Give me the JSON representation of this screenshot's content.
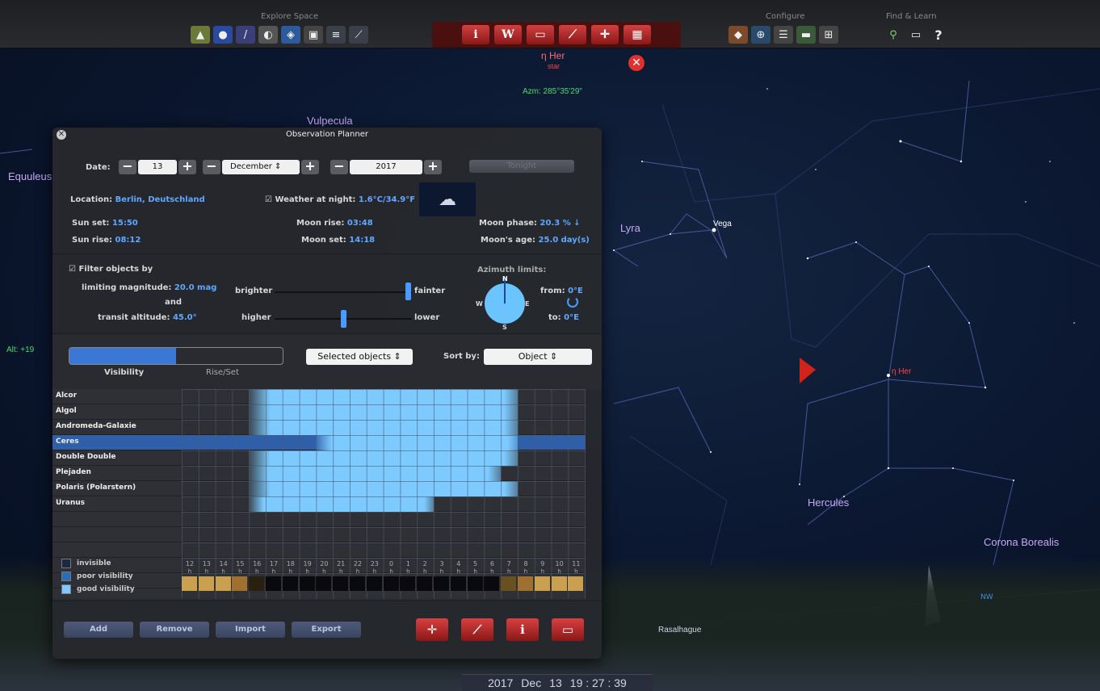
{
  "toolbar": {
    "explore_label": "Explore Space",
    "configure_label": "Configure",
    "find_label": "Find & Learn"
  },
  "sky": {
    "constellations": [
      "Vulpecula",
      "Equuleus",
      "Lyra",
      "Hercules",
      "Corona Borealis"
    ],
    "stars": [
      "Vega",
      "Rasalhague"
    ],
    "selected_marker": "η Her",
    "alt_readout": "Alt: +19",
    "nw_label": "NW"
  },
  "object_info": {
    "name": "η Her",
    "type": "star",
    "azimuth": "Azm: 285°35'29\""
  },
  "datetime": {
    "year": "2017",
    "month": "Dec",
    "day": "13",
    "time": "19 : 27 : 39"
  },
  "planner": {
    "title": "Observation Planner",
    "date_label": "Date:",
    "day": "13",
    "month": "December",
    "year": "2017",
    "tonight_button": "Tonight",
    "location_label": "Location:",
    "location_value": "Berlin, Deutschland",
    "weather_label": "Weather at night:",
    "weather_value": "1.6°C/34.9°F",
    "sun_set_label": "Sun set:",
    "sun_set": "15:50",
    "sun_rise_label": "Sun rise:",
    "sun_rise": "08:12",
    "moon_rise_label": "Moon rise:",
    "moon_rise": "03:48",
    "moon_set_label": "Moon set:",
    "moon_set": "14:18",
    "moon_phase_label": "Moon phase:",
    "moon_phase": "20.3 % ↓",
    "moon_age_label": "Moon's age:",
    "moon_age": "25.0 day(s)",
    "filter_label": "Filter objects by",
    "limmag_label": "limiting magnitude:",
    "limmag_value": "20.0 mag",
    "and_label": "and",
    "transit_label": "transit altitude:",
    "transit_value": "45.0°",
    "brighter": "brighter",
    "fainter": "fainter",
    "higher": "higher",
    "lower": "lower",
    "azimuth_label": "Azimuth limits:",
    "from_label": "from:",
    "from_value": "0°E",
    "to_label": "to:",
    "to_value": "0°E",
    "compass": {
      "n": "N",
      "s": "S",
      "e": "E",
      "w": "W"
    },
    "tab_visibility": "Visibility",
    "tab_riseset": "Rise/Set",
    "selected_objects": "Selected objects",
    "sort_by_label": "Sort by:",
    "sort_value": "Object",
    "objects": [
      "Alcor",
      "Algol",
      "Andromeda-Galaxie",
      "Ceres",
      "Double Double",
      "Plejaden",
      "Polaris (Polarstern)",
      "Uranus"
    ],
    "selected_object_index": 3,
    "legend": {
      "invisible": "invisible",
      "poor": "poor visibility",
      "good": "good visibility"
    },
    "hours": [
      "12",
      "13",
      "14",
      "15",
      "16",
      "17",
      "18",
      "19",
      "20",
      "21",
      "22",
      "23",
      "0",
      "1",
      "2",
      "3",
      "4",
      "5",
      "6",
      "7",
      "8",
      "9",
      "10",
      "11"
    ],
    "hour_unit": "h",
    "buttons": {
      "add": "Add",
      "remove": "Remove",
      "import": "Import",
      "export": "Export"
    },
    "colors": {
      "good": "#7ccaff",
      "poor": "#2a6db8",
      "invisible": "#1b2a44"
    }
  }
}
